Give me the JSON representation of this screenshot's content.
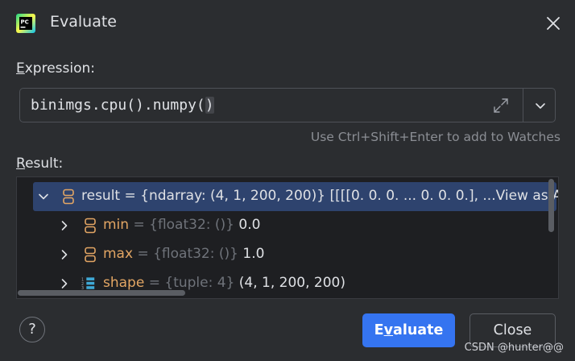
{
  "window": {
    "title": "Evaluate",
    "app_icon": "pycharm-logo",
    "close_icon": "close-icon"
  },
  "expression": {
    "label_first": "E",
    "label_rest": "xpression:",
    "code_before": "binimgs.cpu().numpy(",
    "code_paren": ")",
    "hint": "Use Ctrl+Shift+Enter to add to Watches"
  },
  "result": {
    "label_first": "R",
    "label_rest": "esult:",
    "rows": [
      {
        "name": "result",
        "eq": " = ",
        "type": "{ndarray: (4, 1, 200, 200)}",
        "value": " [[[[0. 0. 0. ... 0. 0. 0.], ...",
        "link": "View as Array"
      },
      {
        "name": "min",
        "eq": " = ",
        "type": "{float32: ()}",
        "value": " 0.0"
      },
      {
        "name": "max",
        "eq": " = ",
        "type": "{float32: ()}",
        "value": " 1.0"
      },
      {
        "name": "shape",
        "eq": " = ",
        "type": "{tuple: 4}",
        "value": " (4, 1, 200, 200)"
      }
    ]
  },
  "buttons": {
    "help": "?",
    "evaluate_before": "E",
    "evaluate_mnemonic": "v",
    "evaluate_after": "aluate",
    "close": "Close"
  },
  "watermark": "CSDN @hunter@@",
  "colors": {
    "background": "#2b2d30",
    "accent": "#3574f0",
    "selection": "#2e436e",
    "var_name": "#e3a664",
    "type_hint": "#6f737a"
  }
}
